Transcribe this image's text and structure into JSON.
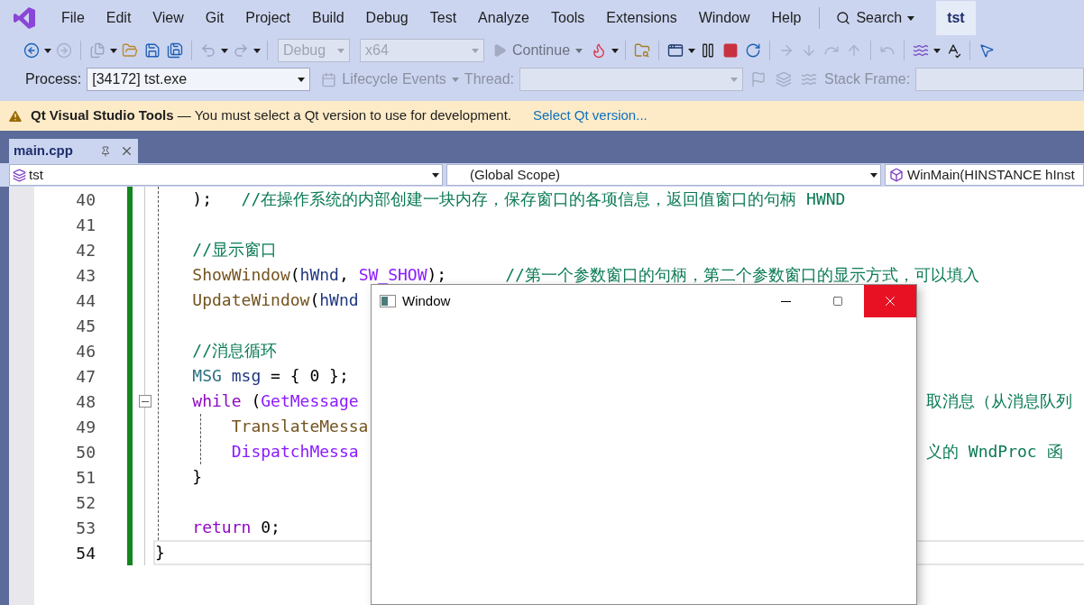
{
  "menu": [
    {
      "label": "File"
    },
    {
      "label": "Edit"
    },
    {
      "label": "View"
    },
    {
      "label": "Git"
    },
    {
      "label": "Project"
    },
    {
      "label": "Build"
    },
    {
      "label": "Debug"
    },
    {
      "label": "Test"
    },
    {
      "label": "Analyze"
    },
    {
      "label": "Tools"
    },
    {
      "label": "Extensions"
    },
    {
      "label": "Window"
    },
    {
      "label": "Help"
    }
  ],
  "search": {
    "label": "Search"
  },
  "solution_badge": "tst",
  "toolbar": {
    "configuration": {
      "value": "Debug",
      "disabled": true
    },
    "platform": {
      "value": "x64",
      "disabled": true
    },
    "continue": {
      "label": "Continue",
      "disabled": true
    }
  },
  "debug_bar": {
    "process_label": "Process:",
    "process": "[34172] tst.exe",
    "lifecycle": {
      "label": "Lifecycle Events",
      "disabled": true
    },
    "thread_label": "Thread:",
    "stack_frame_label": "Stack Frame:"
  },
  "info_bar": {
    "message": "**Qt Visual Studio Tools** — You must select a Qt version to use for development.",
    "link": "Select Qt version..."
  },
  "tabs": [
    {
      "label": "main.cpp",
      "selected": true
    }
  ],
  "navigation": {
    "project": "tst",
    "scope": "(Global Scope)",
    "member": "WinMain(HINSTANCE hInst"
  },
  "code_lines": [
    {
      "number": "40",
      "current": false,
      "left": [
        {
          "kind": "plain",
          "text": "    );"
        },
        {
          "kind": "comment",
          "text": "   //在操作系统的内部创建一块内存，保存窗口的各项信息，返回值窗口的句柄 HWND"
        }
      ]
    },
    {
      "number": "41",
      "current": false
    },
    {
      "number": "42",
      "current": false,
      "left": [
        {
          "kind": "comment",
          "text": "    //显示窗口"
        }
      ]
    },
    {
      "number": "43",
      "current": false,
      "left": [
        {
          "kind": "function",
          "text": "    ShowWindow"
        },
        {
          "kind": "plain",
          "text": "("
        },
        {
          "kind": "variable",
          "text": "hWnd"
        },
        {
          "kind": "plain",
          "text": ","
        },
        {
          "kind": "macro",
          "text": " SW_SHOW"
        },
        {
          "kind": "plain",
          "text": ");"
        },
        {
          "kind": "comment",
          "text": "      //第一个参数窗口的句柄，第二个参数窗口的显示方式，可以填入"
        }
      ]
    },
    {
      "number": "44",
      "current": false,
      "left": [
        {
          "kind": "function",
          "text": "    UpdateWindow"
        },
        {
          "kind": "plain",
          "text": "("
        },
        {
          "kind": "variable",
          "text": "hWnd"
        }
      ]
    },
    {
      "number": "45",
      "current": false
    },
    {
      "number": "46",
      "current": false,
      "left": [
        {
          "kind": "comment",
          "text": "    //消息循环"
        }
      ]
    },
    {
      "number": "47",
      "current": false,
      "left": [
        {
          "kind": "type",
          "text": "    MSG"
        },
        {
          "kind": "variable",
          "text": " msg"
        },
        {
          "kind": "plain",
          "text": " = { 0 };"
        }
      ]
    },
    {
      "number": "48",
      "current": false,
      "fold": {
        "expanded": true
      },
      "left": [
        {
          "kind": "keyword",
          "text": "    while"
        },
        {
          "kind": "plain",
          "text": " ("
        },
        {
          "kind": "macro",
          "text": "GetMessage"
        }
      ],
      "right": [
        {
          "kind": "comment",
          "text": "取消息（从消息队列"
        }
      ]
    },
    {
      "number": "49",
      "current": false,
      "left": [
        {
          "kind": "function",
          "text": "        TranslateMessa"
        }
      ]
    },
    {
      "number": "50",
      "current": false,
      "left": [
        {
          "kind": "macro",
          "text": "        DispatchMessa"
        }
      ],
      "right": [
        {
          "kind": "comment",
          "text": "义的 WndProc 函"
        }
      ]
    },
    {
      "number": "51",
      "current": false,
      "left": [
        {
          "kind": "plain",
          "text": "    }"
        }
      ]
    },
    {
      "number": "52",
      "current": false
    },
    {
      "number": "53",
      "current": false,
      "left": [
        {
          "kind": "keyword",
          "text": "    return"
        },
        {
          "kind": "plain",
          "text": " 0;"
        }
      ]
    },
    {
      "number": "54",
      "current": true,
      "left": [
        {
          "kind": "plain",
          "text": "}"
        }
      ]
    }
  ],
  "window": {
    "title": "Window"
  }
}
